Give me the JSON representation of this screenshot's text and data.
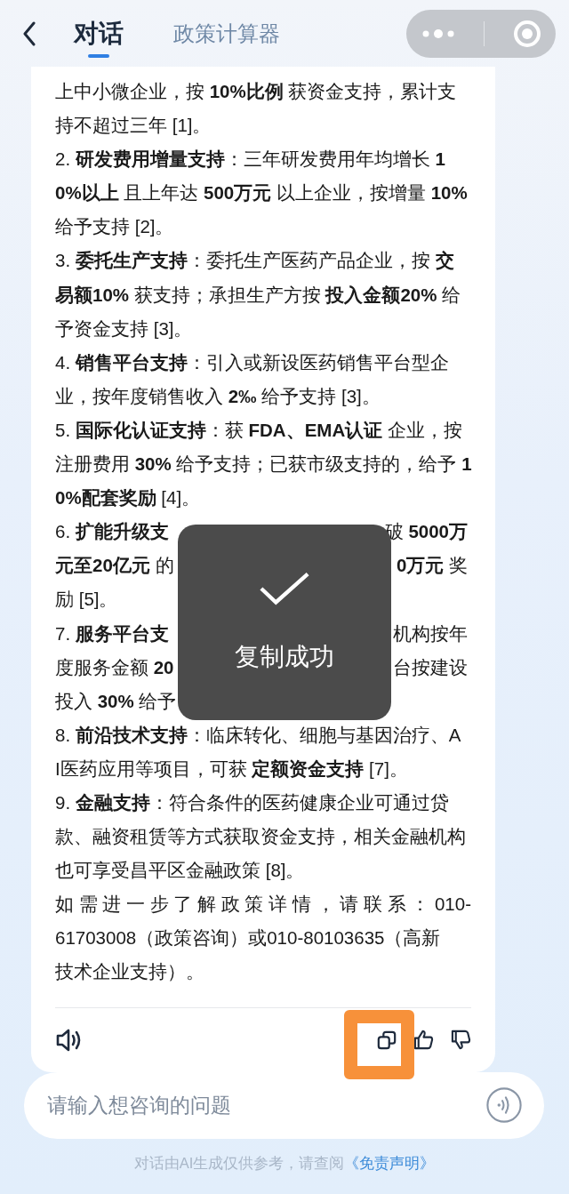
{
  "header": {
    "tabs": [
      {
        "label": "对话",
        "selected": true
      },
      {
        "label": "政策计算器",
        "selected": false
      }
    ]
  },
  "message": {
    "lines": [
      {
        "text": "上中小微企业，按 **10%比例** 获资金支持，累计支"
      },
      {
        "text": "持不超过三年 [1]。"
      },
      {
        "text": "2. **研发费用增量支持**：三年研发费用年均增长 **1**"
      },
      {
        "text": "**0%以上** 且上年达 **500万元** 以上企业，按增量 **10%**"
      },
      {
        "text": "给予支持 [2]。"
      },
      {
        "text": "3. **委托生产支持**：委托生产医药产品企业，按 **交**"
      },
      {
        "text": "**易额10%** 获支持；承担生产方按 **投入金额20%** 给"
      },
      {
        "text": "予资金支持 [3]。"
      },
      {
        "text": "4. **销售平台支持**：引入或新设医药销售平台型企"
      },
      {
        "text": "业，按年度销售收入 **2‰** 给予支持 [3]。"
      },
      {
        "text": "5. **国际化认证支持**：获 **FDA、EMA认证** 企业，按"
      },
      {
        "text": "注册费用 **30%** 给予支持；已获市级支持的，给予 **1**"
      },
      {
        "text": "**0%配套奖励** [4]。"
      },
      {
        "text": "6. **扩能升级支**",
        "right": "破 **5000万**"
      },
      {
        "text": "**元至20亿元** 的",
        "right": "**0万元** 奖"
      },
      {
        "text": "励 [5]。"
      },
      {
        "text": "7. **服务平台支**",
        "right": "机构按年"
      },
      {
        "text": "度服务金额 **20**",
        "right": "台按建设"
      },
      {
        "text": "投入 **30%** 给予"
      },
      {
        "text": "8. **前沿技术支持**：临床转化、细胞与基因治疗、A"
      },
      {
        "text": "I医药应用等项目，可获 **定额资金支持** [7]。"
      },
      {
        "text": "9. **金融支持**：符合条件的医药健康企业可通过贷"
      },
      {
        "text": "款、融资租赁等方式获取资金支持，相关金融机构"
      },
      {
        "text": "也可享受昌平区金融政策 [8]。"
      },
      {
        "text": "如需进一步了解政策详情，请联系：010-",
        "spread": true
      },
      {
        "text": "61703008（政策咨询）或010-80103635（高新"
      },
      {
        "text": "技术企业支持）。"
      }
    ]
  },
  "toast": {
    "text": "复制成功"
  },
  "input": {
    "placeholder": "请输入想咨询的问题"
  },
  "footer": {
    "text": "对话由AI生成仅供参考，请查阅",
    "link": "《免责声明》"
  }
}
